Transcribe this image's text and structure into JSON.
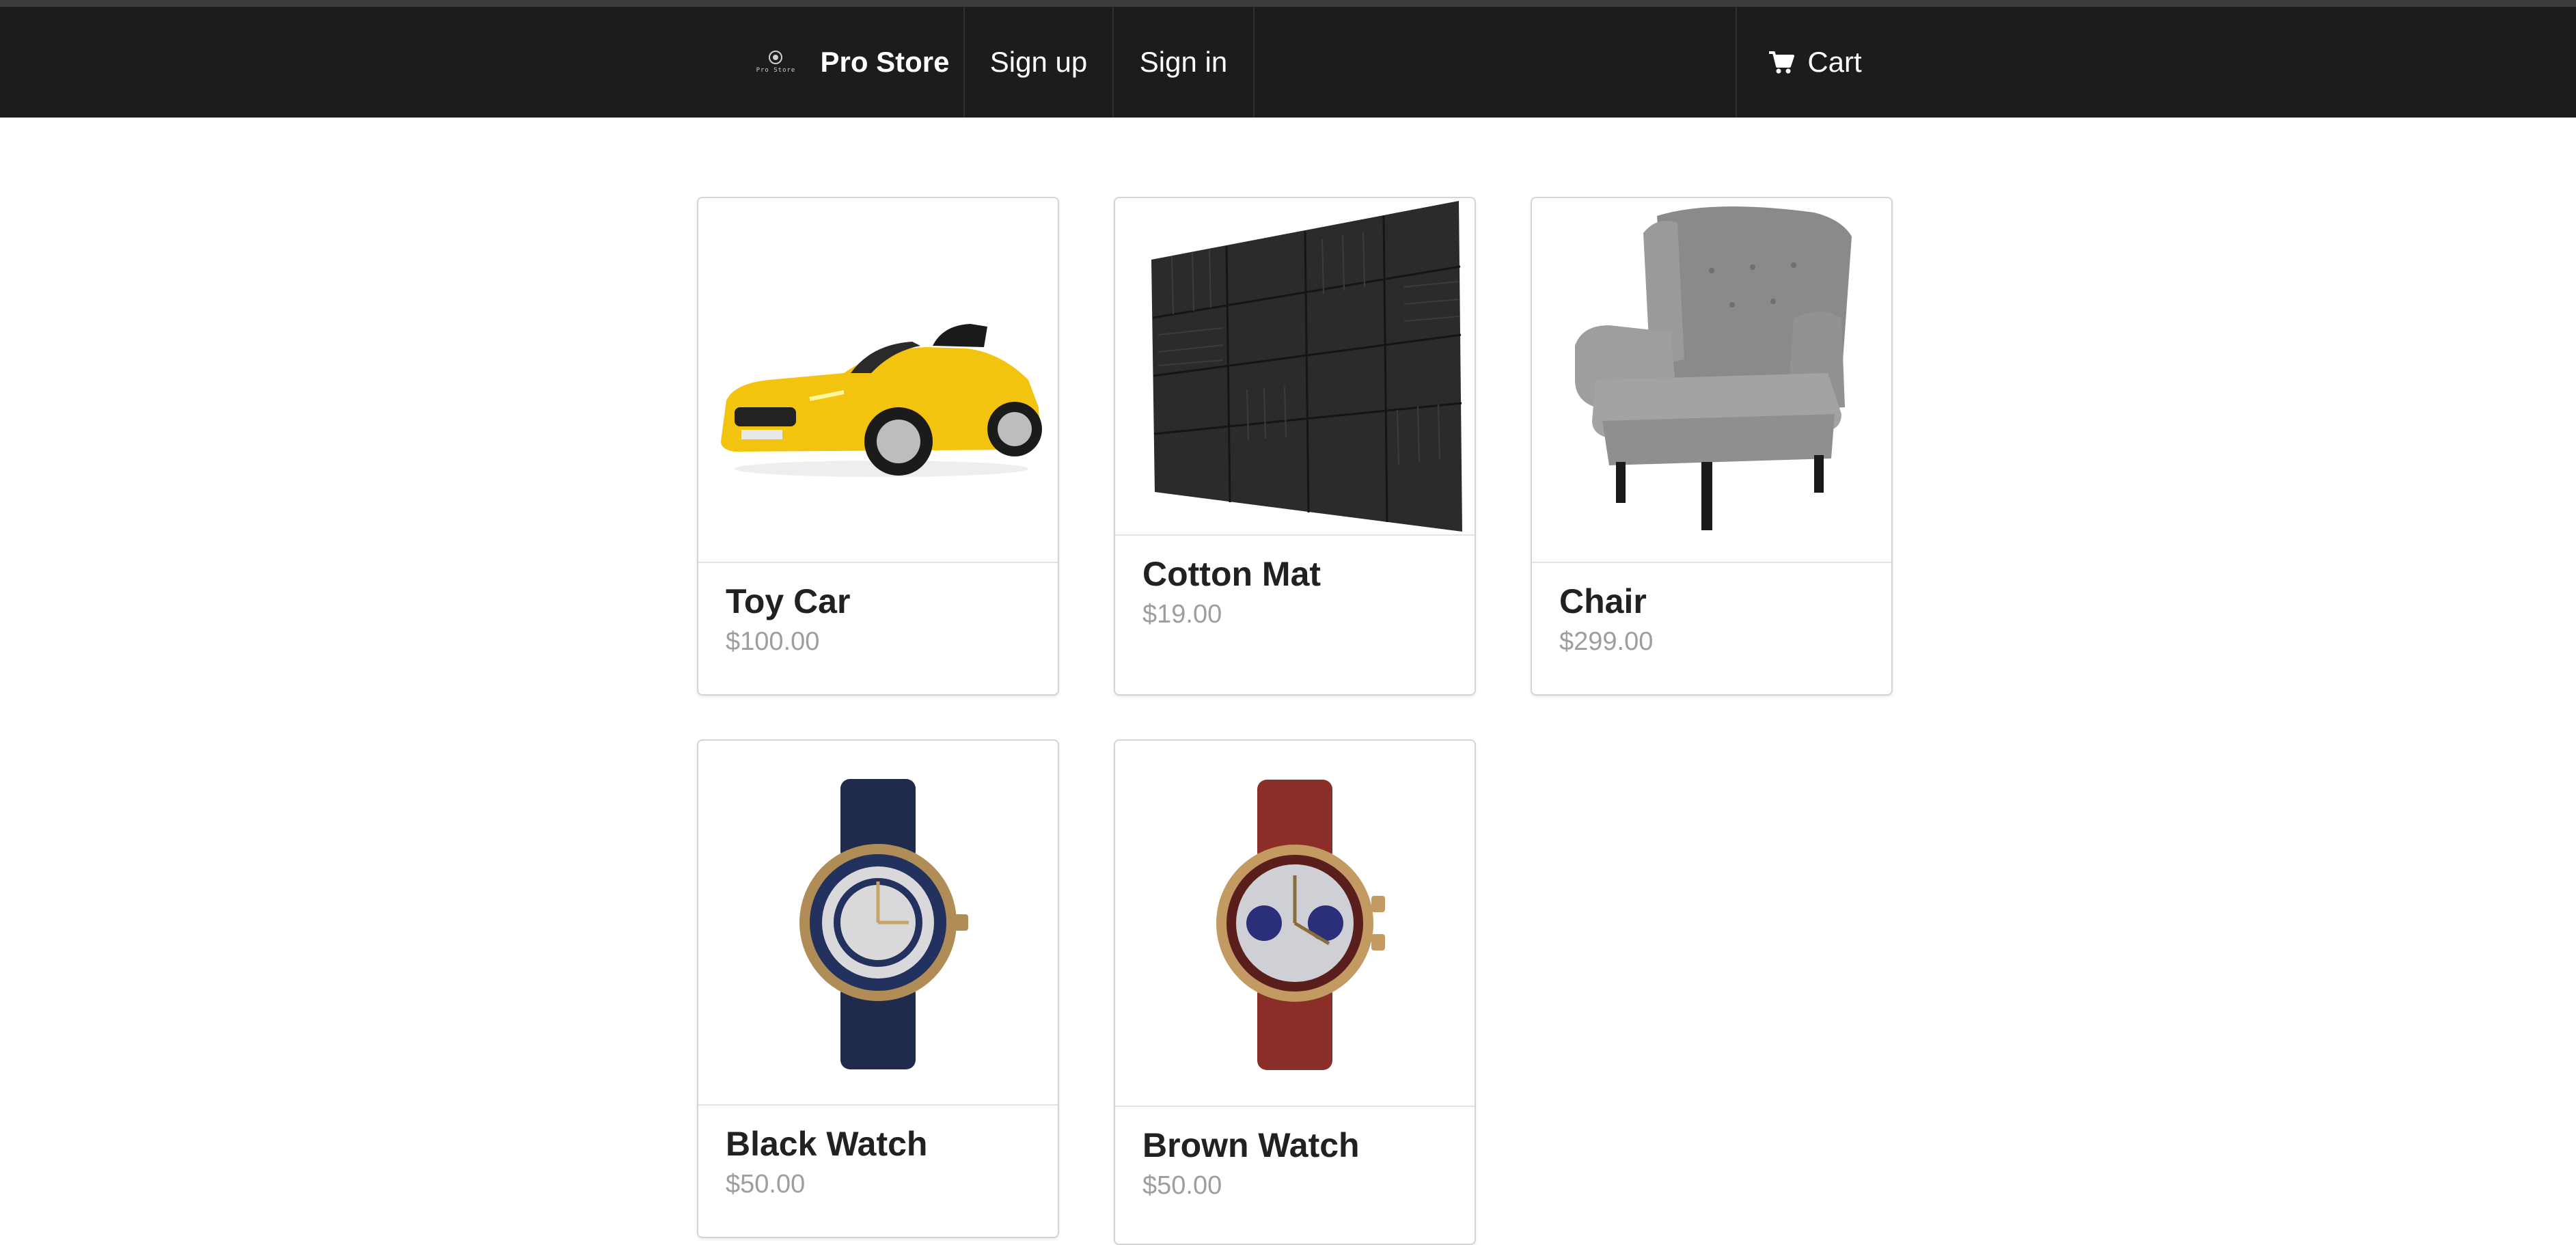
{
  "navbar": {
    "logo_text": "Pro Store",
    "brand": "Pro Store",
    "signup": "Sign up",
    "signin": "Sign in",
    "cart": "Cart"
  },
  "products": [
    {
      "name": "Toy Car",
      "price": "$100.00",
      "image": "yellow-toy-car"
    },
    {
      "name": "Cotton Mat",
      "price": "$19.00",
      "image": "acoustic-foam-mat"
    },
    {
      "name": "Chair",
      "price": "$299.00",
      "image": "grey-armchair"
    },
    {
      "name": "Black Watch",
      "price": "$50.00",
      "image": "navy-strap-watch"
    },
    {
      "name": "Brown Watch",
      "price": "$50.00",
      "image": "brown-strap-watch"
    }
  ],
  "colors": {
    "navbar_bg": "#1b1c1d",
    "price_text": "#9e9e9e",
    "card_border": "#d4d4d5"
  }
}
